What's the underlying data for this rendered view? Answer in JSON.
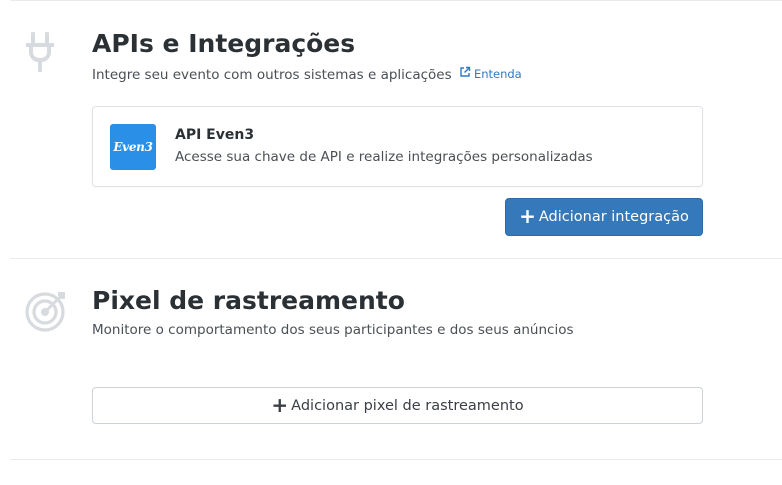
{
  "api_section": {
    "icon": "plug-icon",
    "title": "APIs e Integrações",
    "description": "Integre seu evento com outros sistemas e aplicações",
    "learn_more_label": "Entenda",
    "integrations": [
      {
        "logo_text": "Even3",
        "logo_color": "#2a8fe6",
        "title": "API Even3",
        "description": "Acesse sua chave de API e realize integrações personalizadas"
      }
    ],
    "add_button_icon": "plus-icon",
    "add_button_label": "Adicionar integração"
  },
  "pixel_section": {
    "icon": "target-icon",
    "title": "Pixel de rastreamento",
    "description": "Monitore o comportamento dos seus participantes e dos seus anúncios",
    "add_button_icon": "plus-icon",
    "add_button_label": "Adicionar pixel de rastreamento"
  },
  "colors": {
    "primary": "#3579ba",
    "link": "#3179c0",
    "icon_muted": "#d7dbdf",
    "divider": "#e9ecef"
  }
}
